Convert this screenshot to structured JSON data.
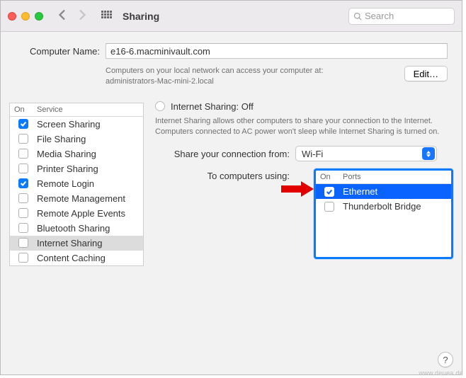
{
  "window": {
    "title": "Sharing"
  },
  "search": {
    "placeholder": "Search"
  },
  "computer_name": {
    "label": "Computer Name:",
    "value": "e16-6.macminivault.com",
    "hint_line1": "Computers on your local network can access your computer at:",
    "hint_line2": "administrators-Mac-mini-2.local",
    "edit_label": "Edit…"
  },
  "services": {
    "header_on": "On",
    "header_service": "Service",
    "items": [
      {
        "label": "Screen Sharing",
        "checked": true,
        "selected": false
      },
      {
        "label": "File Sharing",
        "checked": false,
        "selected": false
      },
      {
        "label": "Media Sharing",
        "checked": false,
        "selected": false
      },
      {
        "label": "Printer Sharing",
        "checked": false,
        "selected": false
      },
      {
        "label": "Remote Login",
        "checked": true,
        "selected": false
      },
      {
        "label": "Remote Management",
        "checked": false,
        "selected": false
      },
      {
        "label": "Remote Apple Events",
        "checked": false,
        "selected": false
      },
      {
        "label": "Bluetooth Sharing",
        "checked": false,
        "selected": false
      },
      {
        "label": "Internet Sharing",
        "checked": false,
        "selected": true
      },
      {
        "label": "Content Caching",
        "checked": false,
        "selected": false
      }
    ]
  },
  "detail": {
    "title": "Internet Sharing: Off",
    "description": "Internet Sharing allows other computers to share your connection to the Internet. Computers connected to AC power won't sleep while Internet Sharing is turned on.",
    "share_from_label": "Share your connection from:",
    "share_from_value": "Wi-Fi",
    "to_ports_label": "To computers using:",
    "ports_header_on": "On",
    "ports_header_ports": "Ports",
    "ports": [
      {
        "label": "Ethernet",
        "checked": true,
        "selected": true
      },
      {
        "label": "Thunderbolt Bridge",
        "checked": false,
        "selected": false
      }
    ]
  },
  "help_label": "?",
  "watermark": "www.deuea.de"
}
